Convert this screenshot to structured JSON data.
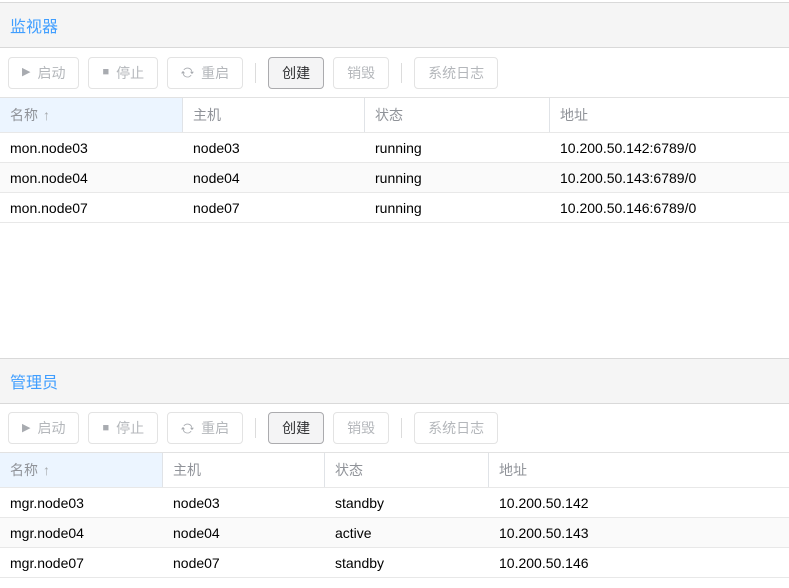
{
  "colors": {
    "accent": "#409EFF",
    "title_band_bg": "#f5f5f5",
    "sorted_header_bg": "#ecf5ff",
    "disabled_text": "#b4b7bb",
    "row_border": "#e8e8e8"
  },
  "icons": {
    "play": "▶",
    "stop": "■",
    "refresh": "arrow-repeat",
    "sort_ascending": "↑"
  },
  "panels": [
    {
      "title": "监视器",
      "toolbar": {
        "start": "启动",
        "stop": "停止",
        "restart": "重启",
        "create": "创建",
        "destroy": "销毁",
        "system_log": "系统日志"
      },
      "table": {
        "columns": [
          "名称",
          "主机",
          "状态",
          "地址"
        ],
        "sorted_by": "名称",
        "rows": [
          [
            "mon.node03",
            "node03",
            "running",
            "10.200.50.142:6789/0"
          ],
          [
            "mon.node04",
            "node04",
            "running",
            "10.200.50.143:6789/0"
          ],
          [
            "mon.node07",
            "node07",
            "running",
            "10.200.50.146:6789/0"
          ]
        ]
      }
    },
    {
      "title": "管理员",
      "toolbar": {
        "start": "启动",
        "stop": "停止",
        "restart": "重启",
        "create": "创建",
        "destroy": "销毁",
        "system_log": "系统日志"
      },
      "table": {
        "columns": [
          "名称",
          "主机",
          "状态",
          "地址"
        ],
        "sorted_by": "名称",
        "rows": [
          [
            "mgr.node03",
            "node03",
            "standby",
            "10.200.50.142"
          ],
          [
            "mgr.node04",
            "node04",
            "active",
            "10.200.50.143"
          ],
          [
            "mgr.node07",
            "node07",
            "standby",
            "10.200.50.146"
          ]
        ]
      }
    }
  ]
}
